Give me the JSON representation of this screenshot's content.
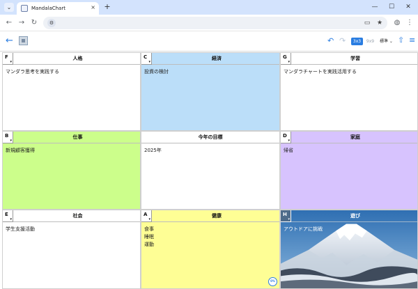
{
  "browser": {
    "tab_title": "MandalaChart",
    "tab_close": "×",
    "new_tab": "+",
    "tab_menu": "⌄",
    "win_min": "—",
    "win_max": "☐",
    "win_close": "✕",
    "nav_back": "←",
    "nav_forward": "→",
    "nav_reload": "↻",
    "icons": [
      "chevron-down-icon",
      "favicon-icon",
      "tab-close-icon",
      "new-tab-icon",
      "minimize-icon",
      "maximize-icon",
      "close-window-icon",
      "back-icon",
      "forward-icon",
      "reload-icon",
      "site-settings-icon",
      "cast-icon",
      "bookmark-star-icon",
      "extensions-icon",
      "kebab-menu-icon"
    ]
  },
  "toolbar": {
    "back": "←",
    "undo": "↶",
    "redo": "↷",
    "size_3x3": "3x3",
    "size_9x9": "9x9",
    "mode": "標準 ⌄",
    "share": "⇧",
    "menu": "≡"
  },
  "cells": [
    {
      "badge": "F",
      "title": "人格",
      "body": "マンダラ思考を実践する",
      "color": "#ffffff"
    },
    {
      "badge": "C",
      "title": "経済",
      "body": "投資の検討",
      "color": "#bbdef9"
    },
    {
      "badge": "G",
      "title": "学習",
      "body": "マンダラチャートを実践活用する",
      "color": "#ffffff"
    },
    {
      "badge": "B",
      "title": "仕事",
      "body": "新規顧客獲得",
      "color": "#ccfe8b"
    },
    {
      "badge": "",
      "title": "今年の目標",
      "body": "2025年",
      "color": "#ffffff"
    },
    {
      "badge": "D",
      "title": "家庭",
      "body": "帰省",
      "color": "#d7c3fe"
    },
    {
      "badge": "E",
      "title": "社会",
      "body": "学生支援活動",
      "color": "#ffffff"
    },
    {
      "badge": "A",
      "title": "健康",
      "body": "食事\n睡眠\n運動",
      "color": "#fefe95"
    },
    {
      "badge": "H",
      "title": "遊び",
      "body": "アウトドアに挑戦",
      "color": "photo"
    }
  ],
  "progress_badge": "0%"
}
